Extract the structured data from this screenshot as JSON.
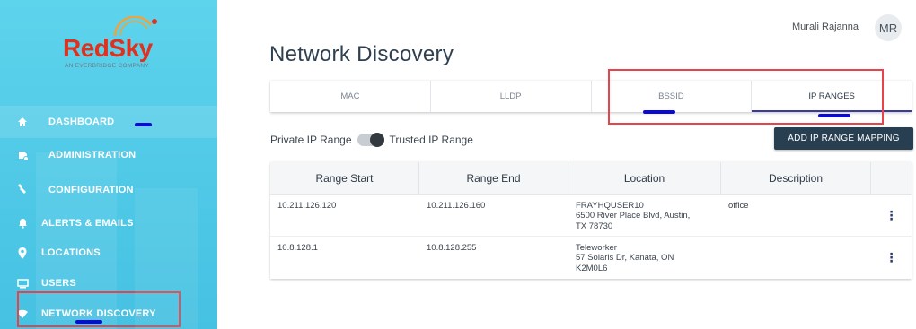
{
  "brand": {
    "name": "RedSky",
    "tagline": "AN EVERBRIDGE COMPANY"
  },
  "sidebar": {
    "items": [
      {
        "label": "DASHBOARD",
        "icon": "home-icon"
      },
      {
        "label": "ADMINISTRATION",
        "icon": "admin-gear-icon"
      },
      {
        "label": "CONFIGURATION",
        "icon": "wrench-icon"
      },
      {
        "label": "ALERTS & EMAILS",
        "icon": "bell-icon"
      },
      {
        "label": "LOCATIONS",
        "icon": "location-pin-icon"
      },
      {
        "label": "USERS",
        "icon": "monitor-icon"
      },
      {
        "label": "NETWORK DISCOVERY",
        "icon": "wifi-icon"
      }
    ]
  },
  "header": {
    "user_name": "Murali Rajanna",
    "avatar_initials": "MR"
  },
  "page": {
    "title": "Network Discovery"
  },
  "tabs": [
    {
      "label": "MAC"
    },
    {
      "label": "LLDP"
    },
    {
      "label": "BSSID"
    },
    {
      "label": "IP RANGES",
      "active": true
    }
  ],
  "toggle": {
    "left_label": "Private IP Range",
    "right_label": "Trusted IP Range"
  },
  "add_button": "ADD IP RANGE MAPPING",
  "table": {
    "columns": [
      "Range Start",
      "Range End",
      "Location",
      "Description"
    ],
    "rows": [
      {
        "range_start": "10.211.126.120",
        "range_end": "10.211.126.160",
        "location_name": "FRAYHQUSER10",
        "location_addr1": "6500 River Place Blvd, Austin,",
        "location_addr2": "TX 78730",
        "description": "office",
        "menu": "⋮"
      },
      {
        "range_start": "10.8.128.1",
        "range_end": "10.8.128.255",
        "location_name": "Teleworker",
        "location_addr1": "57 Solaris Dr, Kanata, ON",
        "location_addr2": "K2M0L6",
        "description": "",
        "menu": "⋮"
      }
    ]
  },
  "colors": {
    "sidebar": "#4ec8e6",
    "brand_red": "#e0301e",
    "button": "#283f52",
    "annotation_box": "#e8434a",
    "annotation_line": "#0a0ad6"
  }
}
